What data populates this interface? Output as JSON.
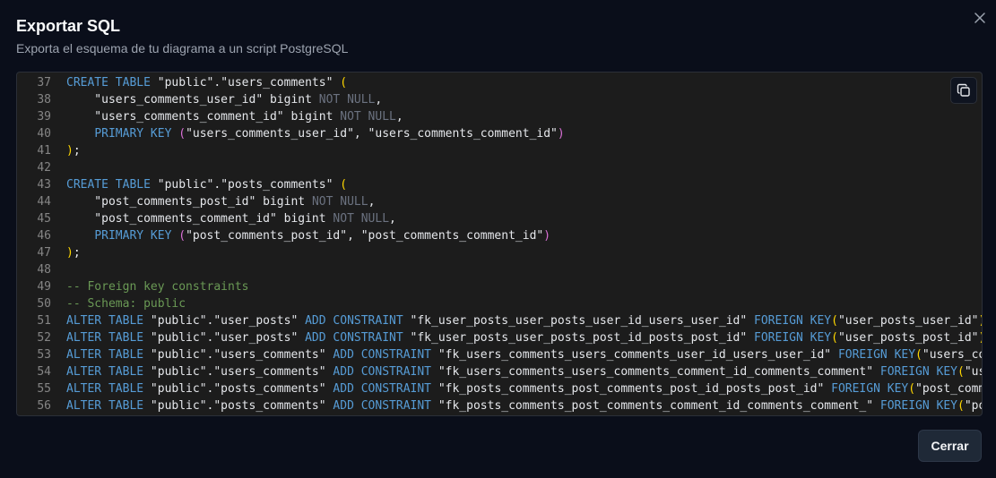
{
  "dialog": {
    "title": "Exportar SQL",
    "subtitle": "Exporta el esquema de tu diagrama a un script PostgreSQL",
    "close_icon": "close-icon",
    "copy_icon": "copy-icon",
    "close_button_label": "Cerrar"
  },
  "code": {
    "lines": [
      {
        "n": "37",
        "tokens": [
          [
            "kw",
            "CREATE TABLE"
          ],
          [
            "txt",
            " \"public\".\"users_comments\" "
          ],
          [
            "paren",
            "("
          ]
        ]
      },
      {
        "n": "38",
        "tokens": [
          [
            "txt",
            "    \"users_comments_user_id\" bigint "
          ],
          [
            "nu",
            "NOT NULL"
          ],
          [
            "txt",
            ","
          ]
        ]
      },
      {
        "n": "39",
        "tokens": [
          [
            "txt",
            "    \"users_comments_comment_id\" bigint "
          ],
          [
            "nu",
            "NOT NULL"
          ],
          [
            "txt",
            ","
          ]
        ]
      },
      {
        "n": "40",
        "tokens": [
          [
            "txt",
            "    "
          ],
          [
            "kw",
            "PRIMARY KEY"
          ],
          [
            "txt",
            " "
          ],
          [
            "paren2",
            "("
          ],
          [
            "txt",
            "\"users_comments_user_id\", \"users_comments_comment_id\""
          ],
          [
            "paren2",
            ")"
          ]
        ]
      },
      {
        "n": "41",
        "tokens": [
          [
            "paren",
            ")"
          ],
          [
            "txt",
            ";"
          ]
        ]
      },
      {
        "n": "42",
        "tokens": []
      },
      {
        "n": "43",
        "tokens": [
          [
            "kw",
            "CREATE TABLE"
          ],
          [
            "txt",
            " \"public\".\"posts_comments\" "
          ],
          [
            "paren",
            "("
          ]
        ]
      },
      {
        "n": "44",
        "tokens": [
          [
            "txt",
            "    \"post_comments_post_id\" bigint "
          ],
          [
            "nu",
            "NOT NULL"
          ],
          [
            "txt",
            ","
          ]
        ]
      },
      {
        "n": "45",
        "tokens": [
          [
            "txt",
            "    \"post_comments_comment_id\" bigint "
          ],
          [
            "nu",
            "NOT NULL"
          ],
          [
            "txt",
            ","
          ]
        ]
      },
      {
        "n": "46",
        "tokens": [
          [
            "txt",
            "    "
          ],
          [
            "kw",
            "PRIMARY KEY"
          ],
          [
            "txt",
            " "
          ],
          [
            "paren2",
            "("
          ],
          [
            "txt",
            "\"post_comments_post_id\", \"post_comments_comment_id\""
          ],
          [
            "paren2",
            ")"
          ]
        ]
      },
      {
        "n": "47",
        "tokens": [
          [
            "paren",
            ")"
          ],
          [
            "txt",
            ";"
          ]
        ]
      },
      {
        "n": "48",
        "tokens": []
      },
      {
        "n": "49",
        "tokens": [
          [
            "cm",
            "-- Foreign key constraints"
          ]
        ]
      },
      {
        "n": "50",
        "tokens": [
          [
            "cm",
            "-- Schema: public"
          ]
        ]
      },
      {
        "n": "51",
        "tokens": [
          [
            "kw",
            "ALTER TABLE"
          ],
          [
            "txt",
            " \"public\".\"user_posts\" "
          ],
          [
            "kw",
            "ADD CONSTRAINT"
          ],
          [
            "txt",
            " \"fk_user_posts_user_posts_user_id_users_user_id\" "
          ],
          [
            "kw",
            "FOREIGN KEY"
          ],
          [
            "paren",
            "("
          ],
          [
            "txt",
            "\"user_posts_user_id\""
          ],
          [
            "paren",
            ")"
          ],
          [
            "txt",
            " "
          ],
          [
            "kw",
            "R"
          ]
        ]
      },
      {
        "n": "52",
        "tokens": [
          [
            "kw",
            "ALTER TABLE"
          ],
          [
            "txt",
            " \"public\".\"user_posts\" "
          ],
          [
            "kw",
            "ADD CONSTRAINT"
          ],
          [
            "txt",
            " \"fk_user_posts_user_posts_post_id_posts_post_id\" "
          ],
          [
            "kw",
            "FOREIGN KEY"
          ],
          [
            "paren",
            "("
          ],
          [
            "txt",
            "\"user_posts_post_id\""
          ],
          [
            "paren",
            ")"
          ],
          [
            "txt",
            " "
          ],
          [
            "kw",
            "R"
          ]
        ]
      },
      {
        "n": "53",
        "tokens": [
          [
            "kw",
            "ALTER TABLE"
          ],
          [
            "txt",
            " \"public\".\"users_comments\" "
          ],
          [
            "kw",
            "ADD CONSTRAINT"
          ],
          [
            "txt",
            " \"fk_users_comments_users_comments_user_id_users_user_id\" "
          ],
          [
            "kw",
            "FOREIGN KEY"
          ],
          [
            "paren",
            "("
          ],
          [
            "txt",
            "\"users_comm"
          ]
        ]
      },
      {
        "n": "54",
        "tokens": [
          [
            "kw",
            "ALTER TABLE"
          ],
          [
            "txt",
            " \"public\".\"users_comments\" "
          ],
          [
            "kw",
            "ADD CONSTRAINT"
          ],
          [
            "txt",
            " \"fk_users_comments_users_comments_comment_id_comments_comment\" "
          ],
          [
            "kw",
            "FOREIGN KEY"
          ],
          [
            "paren",
            "("
          ],
          [
            "txt",
            "\"user"
          ]
        ]
      },
      {
        "n": "55",
        "tokens": [
          [
            "kw",
            "ALTER TABLE"
          ],
          [
            "txt",
            " \"public\".\"posts_comments\" "
          ],
          [
            "kw",
            "ADD CONSTRAINT"
          ],
          [
            "txt",
            " \"fk_posts_comments_post_comments_post_id_posts_post_id\" "
          ],
          [
            "kw",
            "FOREIGN KEY"
          ],
          [
            "paren",
            "("
          ],
          [
            "txt",
            "\"post_commen"
          ]
        ]
      },
      {
        "n": "56",
        "tokens": [
          [
            "kw",
            "ALTER TABLE"
          ],
          [
            "txt",
            " \"public\".\"posts_comments\" "
          ],
          [
            "kw",
            "ADD CONSTRAINT"
          ],
          [
            "txt",
            " \"fk_posts_comments_post_comments_comment_id_comments_comment_\" "
          ],
          [
            "kw",
            "FOREIGN KEY"
          ],
          [
            "paren",
            "("
          ],
          [
            "txt",
            "\"post"
          ]
        ]
      }
    ]
  }
}
